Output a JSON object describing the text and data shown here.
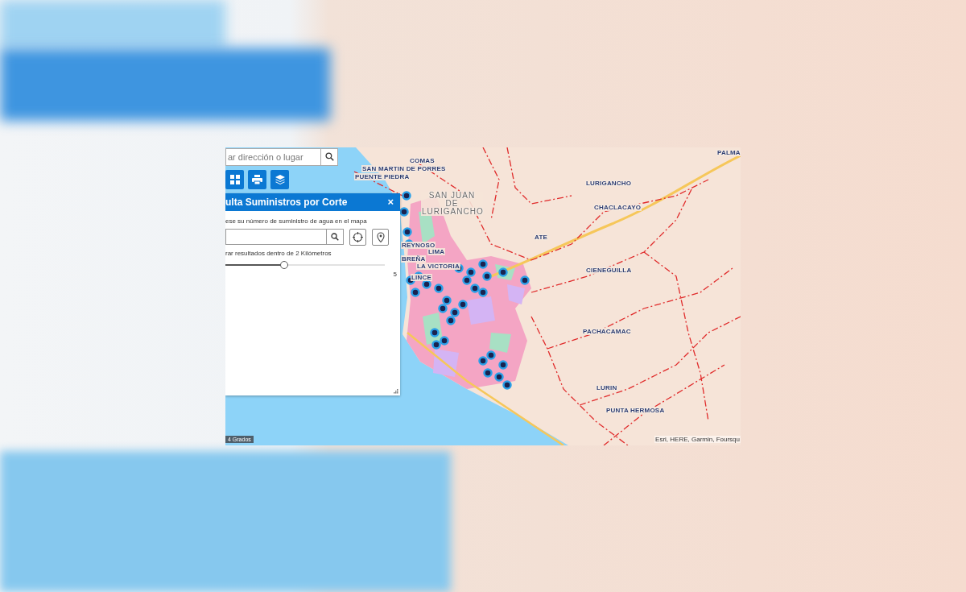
{
  "search": {
    "placeholder": "ar dirección o lugar"
  },
  "panel": {
    "title": "ulta Suministros por Corte",
    "close": "×",
    "instruction": "ese su número de suministro de agua en el mapa",
    "radius_label": "rar resultados dentro de 2 Kilómetros",
    "slider": {
      "level": 0.37
    },
    "slider_max": "5"
  },
  "map": {
    "labels": [
      {
        "text": "PALMA"
      },
      {
        "text": "COMAS"
      },
      {
        "text": "SAN MARTIN DE PORRES"
      },
      {
        "text": "PUENTE PIEDRA"
      },
      {
        "text": "SAN JUAN DE LURIGANCHO"
      },
      {
        "text": "LURIGANCHO"
      },
      {
        "text": "CHACLACAYO"
      },
      {
        "text": "ATE"
      },
      {
        "text": "REYNOSO"
      },
      {
        "text": "LIMA"
      },
      {
        "text": "BREÑA"
      },
      {
        "text": "LA VICTORIA"
      },
      {
        "text": "LINCE"
      },
      {
        "text": "CIENEGUILLA"
      },
      {
        "text": "PACHACAMAC"
      },
      {
        "text": "LURIN"
      },
      {
        "text": "PUNTA HERMOSA"
      }
    ],
    "scale": "4 Grados",
    "attribution": "Esri, HERE, Garmin, Foursqu"
  }
}
